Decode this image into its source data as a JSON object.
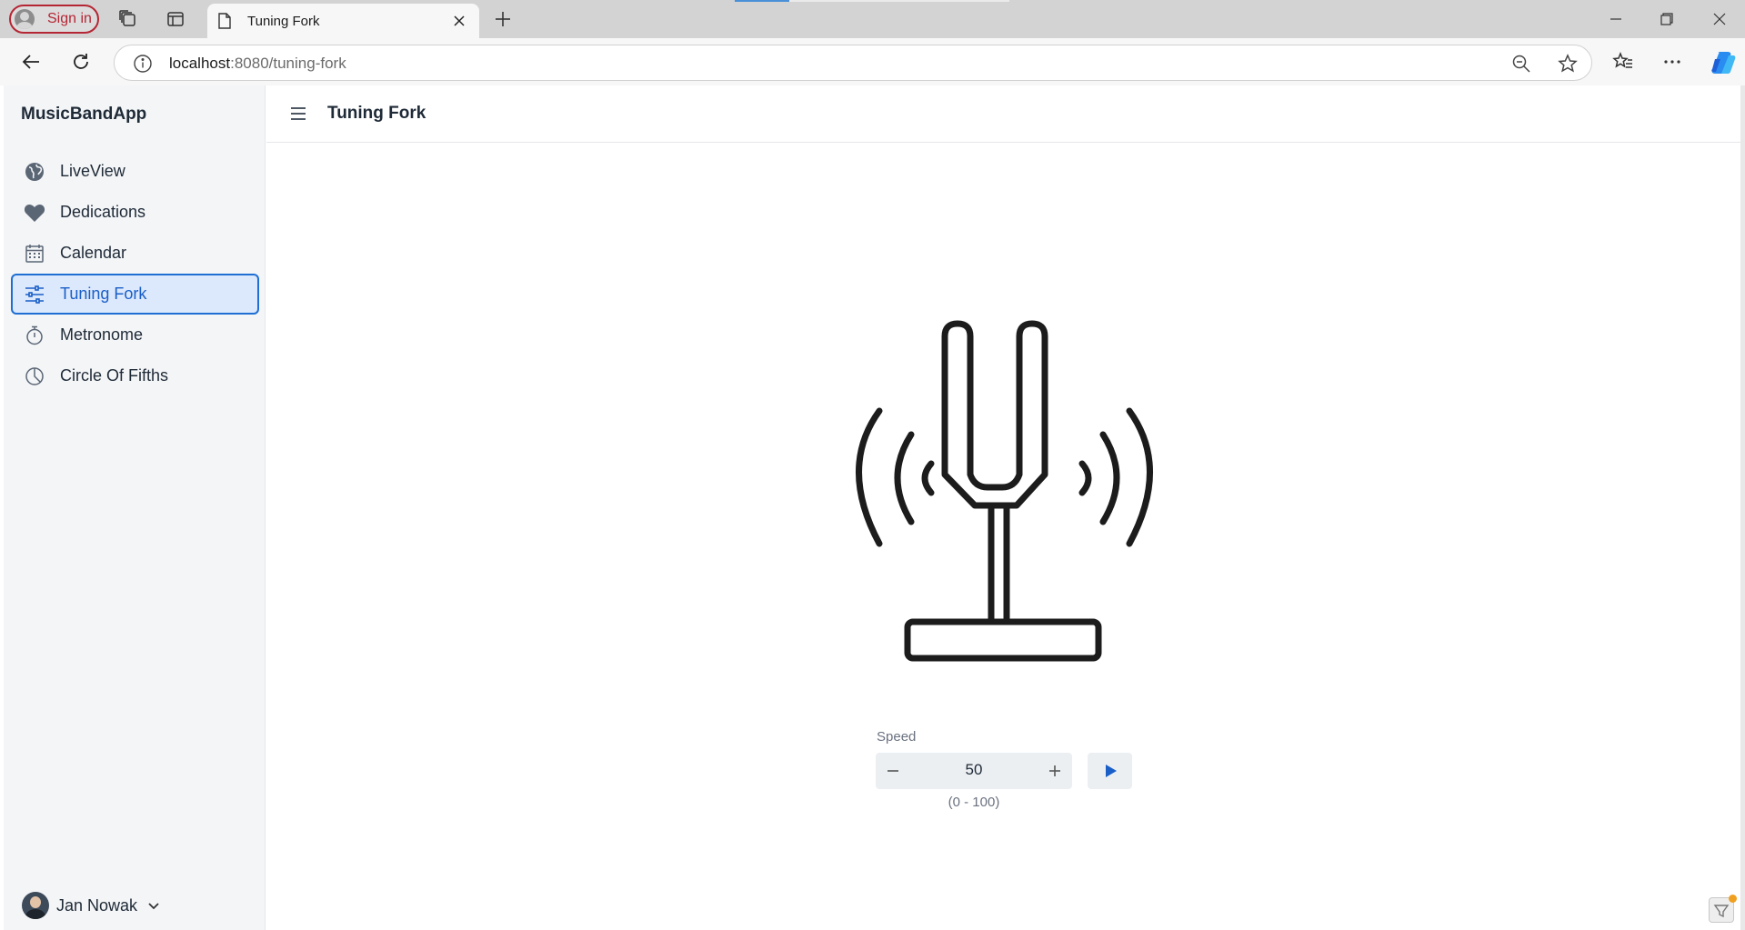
{
  "browser": {
    "signin_label": "Sign in",
    "tab_title": "Tuning Fork",
    "url_host": "localhost",
    "url_path": ":8080/tuning-fork"
  },
  "app": {
    "brand": "MusicBandApp",
    "page_title": "Tuning Fork",
    "sidebar": {
      "items": [
        {
          "label": "LiveView",
          "icon": "globe-icon"
        },
        {
          "label": "Dedications",
          "icon": "heart-icon"
        },
        {
          "label": "Calendar",
          "icon": "calendar-icon"
        },
        {
          "label": "Tuning Fork",
          "icon": "sliders-icon",
          "active": true
        },
        {
          "label": "Metronome",
          "icon": "stopwatch-icon"
        },
        {
          "label": "Circle Of Fifths",
          "icon": "pie-chart-icon"
        }
      ]
    },
    "user": {
      "name": "Jan Nowak"
    },
    "speed": {
      "label": "Speed",
      "value": "50",
      "range": "(0 - 100)"
    }
  },
  "colors": {
    "accent": "#1f6ed4",
    "active_bg": "#dce8fb",
    "signin": "#b52634",
    "play": "#1a5fc8"
  }
}
